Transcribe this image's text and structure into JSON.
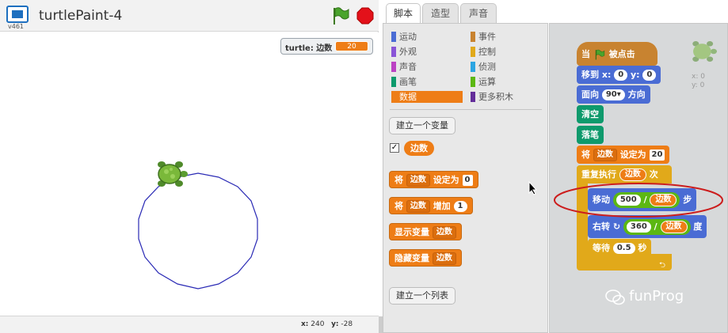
{
  "header": {
    "project_title": "turtlePaint-4",
    "version": "v461"
  },
  "stage": {
    "monitor_label": "turtle: 边数",
    "monitor_value": "20",
    "mouse_x_label": "x:",
    "mouse_x": "240",
    "mouse_y_label": "y:",
    "mouse_y": "-28"
  },
  "tabs": [
    "脚本",
    "造型",
    "声音"
  ],
  "categories": [
    "运动",
    "外观",
    "声音",
    "画笔",
    "数据",
    "事件",
    "控制",
    "侦测",
    "运算",
    "更多积木"
  ],
  "palette": {
    "make_var": "建立一个变量",
    "var_name": "边数",
    "set_block": {
      "a": "将",
      "var": "边数",
      "b": "设定为",
      "val": "0"
    },
    "change_block": {
      "a": "将",
      "var": "边数",
      "b": "增加",
      "val": "1"
    },
    "show_block": {
      "a": "显示变量",
      "var": "边数"
    },
    "hide_block": {
      "a": "隐藏变量",
      "var": "边数"
    },
    "make_list": "建立一个列表"
  },
  "script": {
    "hat": {
      "a": "当",
      "b": "被点击"
    },
    "goto": {
      "a": "移到",
      "x_label": "x:",
      "x": "0",
      "y_label": "y:",
      "y": "0"
    },
    "point": {
      "a": "面向",
      "val": "90",
      "b": "方向"
    },
    "clear": "清空",
    "pendown": "落笔",
    "set": {
      "a": "将",
      "var": "边数",
      "b": "设定为",
      "val": "20"
    },
    "repeat": {
      "a": "重复执行",
      "var": "边数",
      "b": "次"
    },
    "move": {
      "a": "移动",
      "num": "500",
      "op": "/",
      "var": "边数",
      "b": "步"
    },
    "turn": {
      "a": "右转",
      "num": "360",
      "op": "/",
      "var": "边数",
      "b": "度"
    },
    "wait": {
      "a": "等待",
      "val": "0.5",
      "b": "秒"
    },
    "sprite_x": "x: 0",
    "sprite_y": "y: 0"
  },
  "watermark": "funProg",
  "colors": {
    "data": "#ee7d16",
    "motion": "#4a6cd4",
    "pen": "#0e9a6c",
    "control": "#e1a91a",
    "event": "#c88330",
    "highlight": "#cc1d1d"
  }
}
